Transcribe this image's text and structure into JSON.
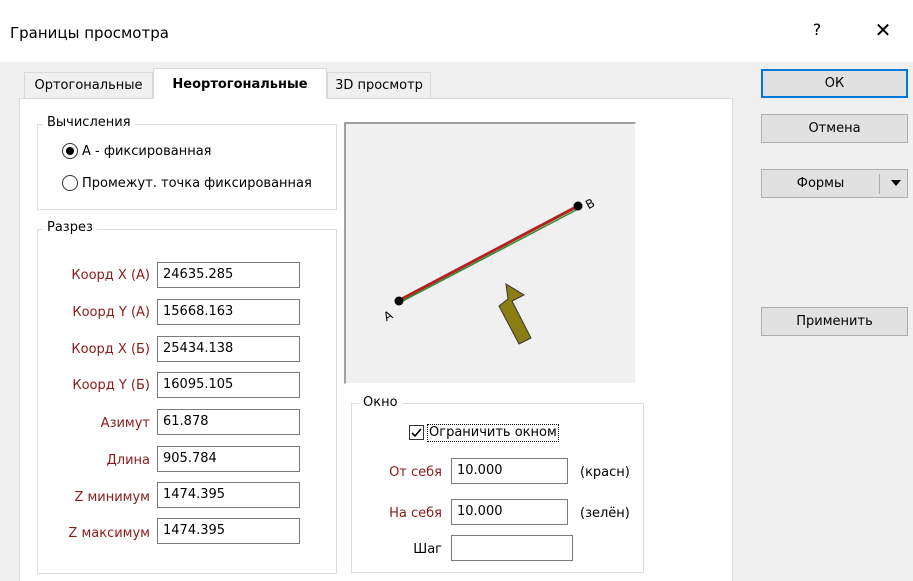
{
  "window": {
    "title": "Границы просмотра",
    "help_label": "?",
    "close_label": "✕"
  },
  "tabs": [
    {
      "label": "Ортогональные",
      "active": false
    },
    {
      "label": "Неортогональные",
      "active": true
    },
    {
      "label": "3D просмотр",
      "active": false
    }
  ],
  "calc_group": {
    "title": "Вычисления",
    "options": [
      {
        "label": "А - фиксированная",
        "selected": true
      },
      {
        "label": "Промежут. точка фиксированная",
        "selected": false
      }
    ]
  },
  "section_group": {
    "title": "Разрез",
    "fields": [
      {
        "label": "Коорд X (А)",
        "value": "24635.285"
      },
      {
        "label": "Коорд Y (А)",
        "value": "15668.163"
      },
      {
        "label": "Коорд X (Б)",
        "value": "25434.138"
      },
      {
        "label": "Коорд Y (Б)",
        "value": "16095.105"
      },
      {
        "label": "Азимут",
        "value": "61.878"
      },
      {
        "label": "Длина",
        "value": "905.784"
      },
      {
        "label": "Z минимум",
        "value": "1474.395"
      },
      {
        "label": "Z максимум",
        "value": "1474.395"
      }
    ]
  },
  "preview": {
    "point_a_label": "A",
    "point_b_label": "B",
    "line_red_color": "#b22222",
    "line_green_color": "#2e8b2e",
    "arrow_color": "#8b7d12"
  },
  "window_group": {
    "title": "Окно",
    "limit_checkbox_label": "Ограничить окном",
    "limit_checked": true,
    "from_label": "От себя",
    "from_value": "10.000",
    "from_unit": "(красн)",
    "to_label": "На себя",
    "to_value": "10.000",
    "to_unit": "(зелён)",
    "step_label": "Шаг",
    "step_value": ""
  },
  "buttons": {
    "ok": "ОК",
    "cancel": "Отмена",
    "forms": "Формы",
    "apply": "Применить"
  }
}
